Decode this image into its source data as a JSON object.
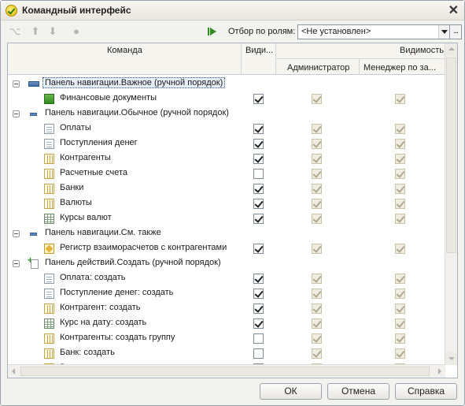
{
  "window": {
    "title": "Командный интерфейс",
    "close_glyph": "✕"
  },
  "toolbar": {
    "icons": [
      "branch-icon",
      "arrow-up-icon",
      "arrow-down-icon",
      "circle-icon",
      "run-icon"
    ],
    "filter_label": "Отбор по ролям:",
    "filter_value": "<Не установлен>",
    "dots": "..."
  },
  "grid": {
    "col_command": "Команда",
    "col_visible": "Види...",
    "col_visibility_group": "Видимость",
    "col_admin": "Администратор",
    "col_manager": "Менеджер по за...",
    "rows": [
      {
        "type": "group",
        "icon": "nav",
        "label": "Панель навигации.Важное (ручной порядок)",
        "selected": true
      },
      {
        "type": "item",
        "icon": "green",
        "label": "Финансовые документы",
        "visible": true,
        "admin": true,
        "manager": true
      },
      {
        "type": "group",
        "icon": "nav-small",
        "label": "Панель навигации.Обычное (ручной порядок)"
      },
      {
        "type": "item",
        "icon": "doc",
        "label": "Оплаты",
        "visible": true,
        "admin": true,
        "manager": true
      },
      {
        "type": "item",
        "icon": "doc",
        "label": "Поступления денег",
        "visible": true,
        "admin": true,
        "manager": true
      },
      {
        "type": "item",
        "icon": "list",
        "label": "Контрагенты",
        "visible": true,
        "admin": true,
        "manager": true
      },
      {
        "type": "item",
        "icon": "list",
        "label": "Расчетные счета",
        "visible": false,
        "admin": true,
        "manager": true
      },
      {
        "type": "item",
        "icon": "list",
        "label": "Банки",
        "visible": true,
        "admin": true,
        "manager": true
      },
      {
        "type": "item",
        "icon": "list",
        "label": "Валюты",
        "visible": true,
        "admin": true,
        "manager": true
      },
      {
        "type": "item",
        "icon": "table",
        "label": "Курсы валют",
        "visible": true,
        "admin": true,
        "manager": true
      },
      {
        "type": "group",
        "icon": "nav-small",
        "label": "Панель навигации.См. также"
      },
      {
        "type": "item",
        "icon": "reg",
        "label": "Регистр взаиморасчетов с контрагентами",
        "visible": true,
        "admin": true,
        "manager": true
      },
      {
        "type": "group",
        "icon": "act",
        "label": "Панель действий.Создать (ручной порядок)"
      },
      {
        "type": "item",
        "icon": "doc",
        "label": "Оплата: создать",
        "visible": true,
        "admin": true,
        "manager": true
      },
      {
        "type": "item",
        "icon": "doc",
        "label": "Поступление денег: создать",
        "visible": true,
        "admin": true,
        "manager": true
      },
      {
        "type": "item",
        "icon": "list",
        "label": "Контрагент: создать",
        "visible": true,
        "admin": true,
        "manager": true
      },
      {
        "type": "item",
        "icon": "table",
        "label": "Курс на дату: создать",
        "visible": true,
        "admin": true,
        "manager": true
      },
      {
        "type": "item",
        "icon": "list",
        "label": "Контрагенты: создать группу",
        "visible": false,
        "admin": true,
        "manager": true
      },
      {
        "type": "item",
        "icon": "list",
        "label": "Банк: создать",
        "visible": false,
        "admin": true,
        "manager": true
      },
      {
        "type": "item",
        "icon": "list",
        "label": "В...",
        "visible": false,
        "admin": true,
        "manager": true
      }
    ]
  },
  "buttons": {
    "ok": "ОК",
    "cancel": "Отмена",
    "help": "Справка"
  }
}
